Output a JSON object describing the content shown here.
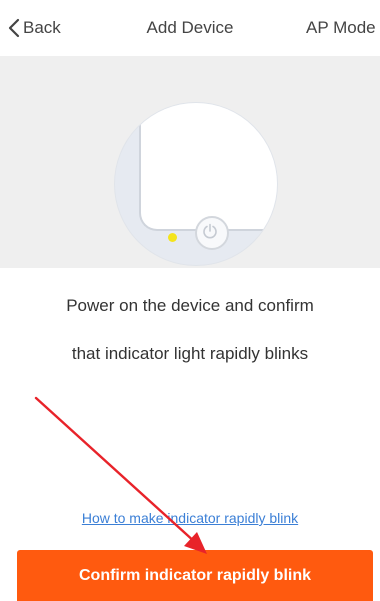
{
  "nav": {
    "back_label": "Back",
    "title": "Add Device",
    "mode_label": "AP Mode"
  },
  "instruction": {
    "line1": "Power on the device and confirm",
    "line2": "that indicator light rapidly blinks"
  },
  "help_link": "How to make indicator rapidly blink",
  "confirm_button": "Confirm indicator rapidly blink",
  "colors": {
    "accent": "#ff5a0f",
    "link": "#3b7fd6",
    "indicator_led": "#f4e41c",
    "annotation_arrow": "#e8232a"
  },
  "icons": {
    "back": "chevron-left-icon",
    "power": "power-icon",
    "annotation": "red-arrow"
  }
}
